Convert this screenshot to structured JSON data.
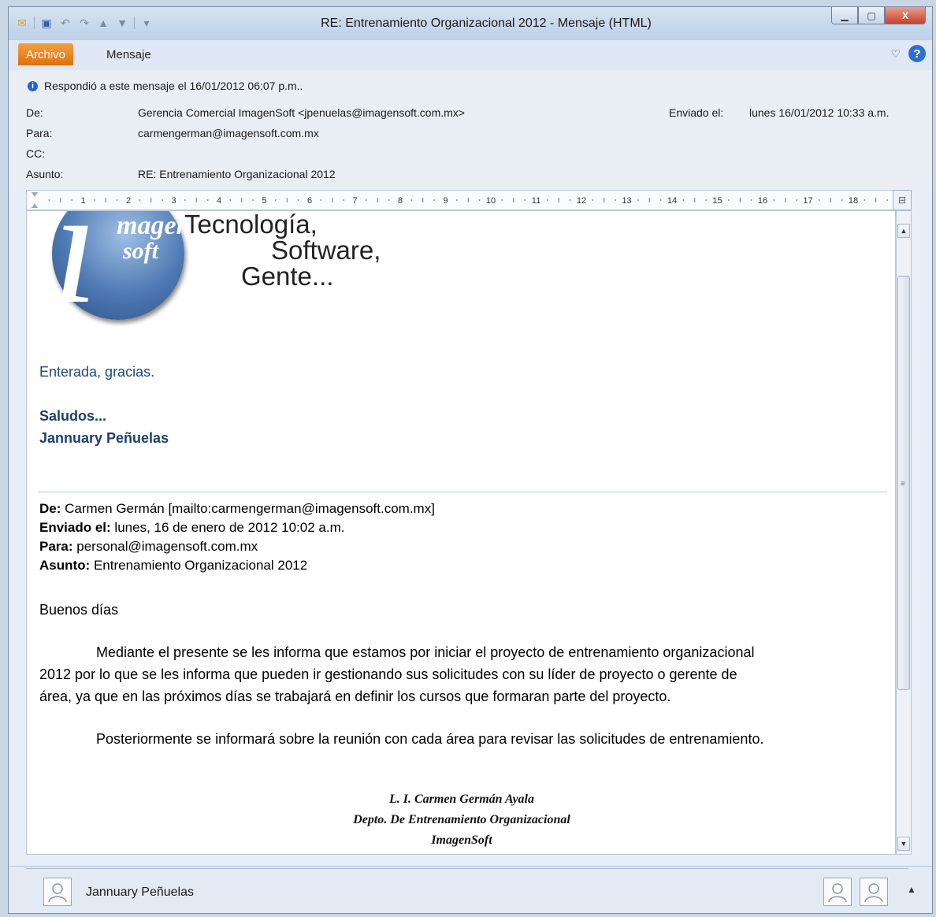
{
  "window": {
    "title": "RE: Entrenamiento Organizacional 2012  -  Mensaje (HTML)",
    "buttons": {
      "minimize": "▁",
      "maximize": "▢",
      "close": "X"
    }
  },
  "ribbon": {
    "tab_file": "Archivo",
    "tab_message": "Mensaje",
    "help": "?"
  },
  "header": {
    "info": "Respondió a este mensaje el 16/01/2012 06:07 p.m..",
    "from_label": "De:",
    "from_value": "Gerencia Comercial ImagenSoft <jpenuelas@imagensoft.com.mx>",
    "to_label": "Para:",
    "to_value": "carmengerman@imagensoft.com.mx",
    "cc_label": "CC:",
    "cc_value": "",
    "subject_label": "Asunto:",
    "subject_value": "RE: Entrenamiento Organizacional 2012",
    "sent_label": "Enviado el:",
    "sent_value": "lunes 16/01/2012 10:33 a.m."
  },
  "ruler": {
    "numbers": [
      "1",
      "2",
      "3",
      "4",
      "5",
      "6",
      "7",
      "8",
      "9",
      "10",
      "11",
      "12",
      "13",
      "14",
      "15",
      "16",
      "17",
      "18"
    ]
  },
  "body": {
    "logo": {
      "glyph": "i",
      "line1": "magen",
      "line2": "soft"
    },
    "slogan": [
      "Tecnología,",
      "Software,",
      "Gente..."
    ],
    "reply": "Enterada, gracias.",
    "closing1": "Saludos...",
    "closing2": "Jannuary Peñuelas",
    "original": {
      "from_label": "De:",
      "from_value": "Carmen Germán [mailto:carmengerman@imagensoft.com.mx]",
      "sent_label": "Enviado el:",
      "sent_value": "lunes, 16 de enero de 2012 10:02 a.m.",
      "to_label": "Para:",
      "to_value": "personal@imagensoft.com.mx",
      "subject_label": "Asunto:",
      "subject_value": "Entrenamiento Organizacional 2012"
    },
    "greeting": "Buenos días",
    "para1_line1": "Mediante el presente se les informa que estamos por iniciar el proyecto de entrenamiento organizacional",
    "para1_line2": "2012 por lo que se les informa que pueden ir  gestionando sus solicitudes con su líder de proyecto o gerente de",
    "para1_line3": "área, ya que en las próximos días se trabajará en definir los cursos que formaran parte del proyecto.",
    "para2": "Posteriormente se informará sobre la reunión con cada área para revisar las solicitudes de entrenamiento.",
    "sig1": "L. I. Carmen Germán Ayala",
    "sig2": "Depto. De Entrenamiento Organizacional",
    "sig3": "ImagenSoft"
  },
  "people_pane": {
    "name": "Jannuary Peñuelas"
  }
}
